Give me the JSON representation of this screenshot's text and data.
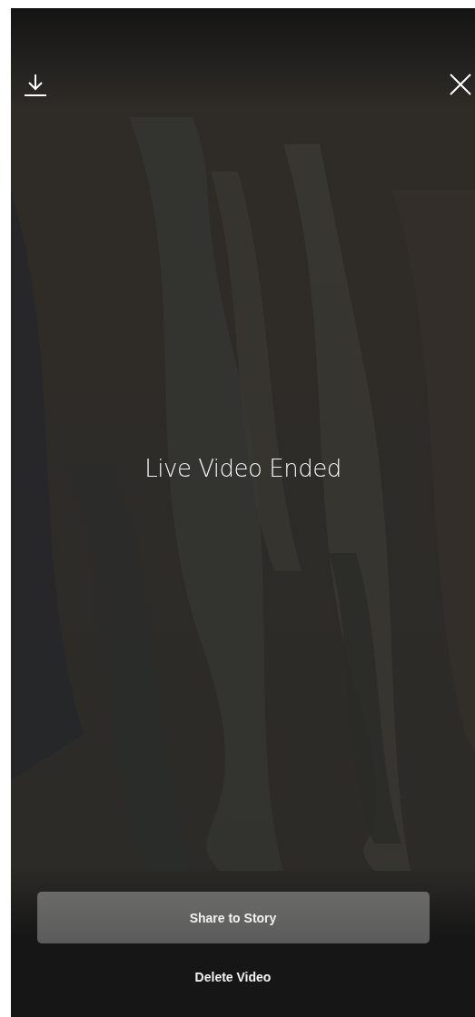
{
  "status_text": "Live Video Ended",
  "buttons": [
    {
      "label": "Share to Story",
      "kind": "filled"
    },
    {
      "label": "Delete Video",
      "kind": "text"
    }
  ]
}
